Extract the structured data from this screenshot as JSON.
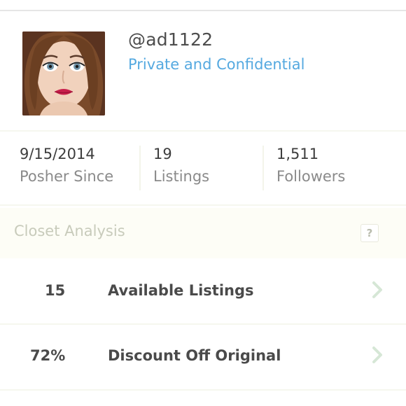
{
  "profile": {
    "username": "@ad1122",
    "bio": "Private and Confidential"
  },
  "stats": [
    {
      "value": "9/15/2014",
      "label": "Posher Since"
    },
    {
      "value": "19",
      "label": "Listings"
    },
    {
      "value": "1,511",
      "label": "Followers"
    }
  ],
  "closet_analysis": {
    "title": "Closet Analysis",
    "help_label": "?",
    "rows": [
      {
        "value": "15",
        "label": "Available Listings"
      },
      {
        "value": "72%",
        "label": "Discount Off Original"
      }
    ]
  },
  "icons": {
    "help": "help-icon",
    "chevron": "chevron-right-icon"
  },
  "colors": {
    "accent_link": "#55a9e0",
    "muted_heading": "#c8cbbb",
    "chevron": "#d6e7d6"
  }
}
